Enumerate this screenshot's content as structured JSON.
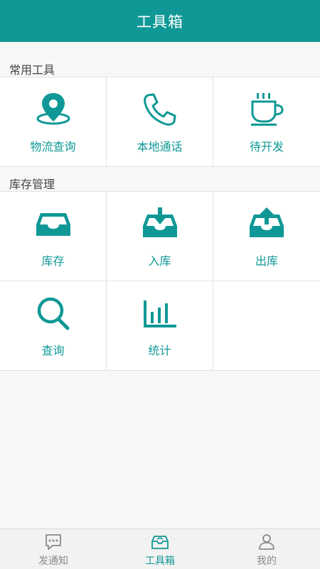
{
  "header": {
    "title": "工具箱"
  },
  "sections": [
    {
      "title": "常用工具",
      "items": [
        {
          "label": "物流查询",
          "icon": "location-pin-icon"
        },
        {
          "label": "本地通话",
          "icon": "phone-icon"
        },
        {
          "label": "待开发",
          "icon": "coffee-cup-icon"
        }
      ]
    },
    {
      "title": "库存管理",
      "items": [
        {
          "label": "库存",
          "icon": "inbox-tray-icon"
        },
        {
          "label": "入库",
          "icon": "tray-download-icon"
        },
        {
          "label": "出库",
          "icon": "tray-upload-icon"
        },
        {
          "label": "查询",
          "icon": "search-icon"
        },
        {
          "label": "统计",
          "icon": "bar-chart-icon"
        }
      ]
    }
  ],
  "tabbar": {
    "tabs": [
      {
        "label": "发通知",
        "icon": "chat-bubble-icon",
        "active": false
      },
      {
        "label": "工具箱",
        "icon": "toolbox-icon",
        "active": true
      },
      {
        "label": "我的",
        "icon": "user-icon",
        "active": false
      }
    ]
  },
  "colors": {
    "accent": "#0f9896",
    "inactive": "#8a8a8a"
  }
}
